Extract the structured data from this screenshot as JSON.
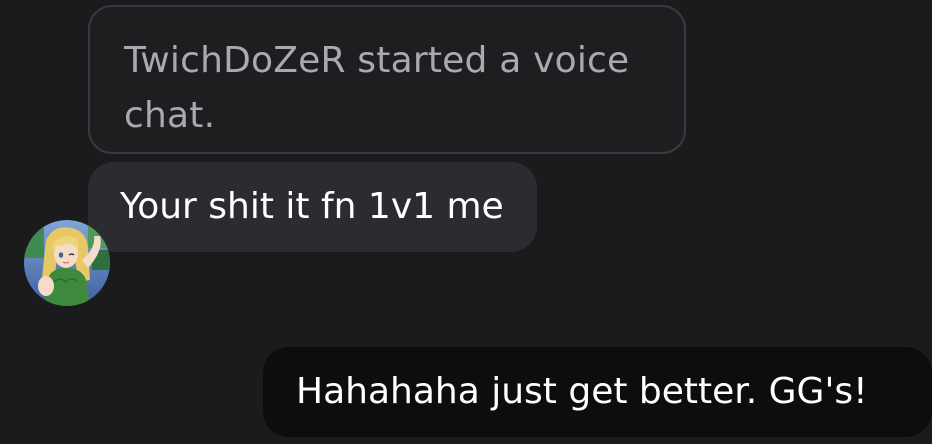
{
  "messages": {
    "system": "TwichDoZeR started a voice chat.",
    "incoming": "Your shit it fn 1v1 me",
    "outgoing": "Hahahaha just get better. GG's!"
  },
  "avatar": {
    "icon": "anime-character-avatar"
  },
  "colors": {
    "background": "#1b1b1d",
    "system_border": "#3a3a3e",
    "incoming_bubble": "#2c2c30",
    "outgoing_bubble": "#0d0d0f"
  }
}
